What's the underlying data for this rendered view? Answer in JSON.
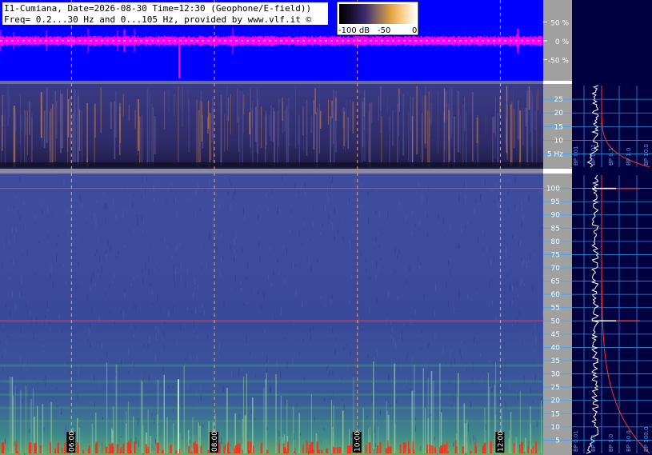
{
  "header": {
    "line1": "I1-Cumiana, Date=2026-08-30 Time=12:30 (Geophone/E-field))",
    "line2": "Freq= 0.2...30 Hz and 0...105 Hz, provided by www.vlf.it ©"
  },
  "colorbar": {
    "labels": [
      "-100 dB",
      "-50",
      "0"
    ],
    "stops": [
      "#000000",
      "#1a1030",
      "#3a2a70",
      "#8a6a60",
      "#e0a040",
      "#ffd090",
      "#ffffff"
    ]
  },
  "colors": {
    "waveform_bg": "#0000ff",
    "waveform_trace": "#ff00ff",
    "side_bg": "#000040",
    "spectrogram_low": "#2a2f7a",
    "hum_line": "#ff3030",
    "time_marker": "#ffb070"
  },
  "chart_data": [
    {
      "type": "line",
      "name_hint": "waveform",
      "ylabel_ticks": [
        "50 %",
        "0 %",
        "-50 %"
      ],
      "y_ticks": [
        50,
        0,
        -50
      ],
      "ylim": [
        -100,
        100
      ]
    },
    {
      "type": "heatmap",
      "name_hint": "spectrogram-low",
      "y_ticks": [
        25,
        20,
        15,
        10,
        5
      ],
      "y_tick_labels": [
        "25",
        "20",
        "15",
        "10",
        "5 Hz"
      ],
      "ylim": [
        0.2,
        30
      ],
      "side_axis_labels": [
        "BP 001",
        "BP 0.01",
        "BP 0.1",
        "BP 1.0",
        "BP 10.0"
      ]
    },
    {
      "type": "heatmap",
      "name_hint": "spectrogram-high",
      "y_ticks": [
        100,
        95,
        90,
        85,
        80,
        75,
        70,
        65,
        60,
        55,
        50,
        45,
        40,
        35,
        30,
        25,
        20,
        15,
        10,
        5
      ],
      "ylim": [
        0,
        105
      ],
      "hum_lines_hz": [
        50,
        100
      ],
      "side_axis_labels": [
        "BP 0.01",
        "BP 0.1",
        "BP 1.0",
        "BP 10.0",
        "BP 100.0"
      ]
    }
  ],
  "time_axis": {
    "labels": [
      "06:00",
      "08:00",
      "10:00",
      "12:00"
    ],
    "positions_hours": [
      6,
      8,
      10,
      12
    ],
    "range_hours": [
      5.0,
      12.6
    ]
  }
}
